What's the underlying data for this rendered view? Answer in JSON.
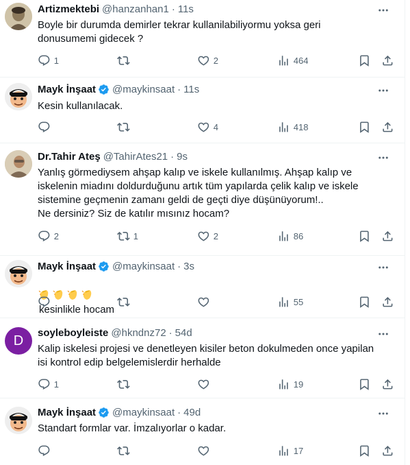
{
  "tweets": [
    {
      "name": "Artizmektebi",
      "handle": "@hanzanhan1",
      "time": "11s",
      "text": "Boyle bir durumda demirler tekrar kullanilabiliyormu yoksa geri\ndonusumemi gidecek ?",
      "replies": "1",
      "retweets": "",
      "likes": "2",
      "views": "464",
      "avatar_icon": "avatar-photo",
      "verified": false
    },
    {
      "name": "Mayk İnşaat",
      "handle": "@maykinsaat",
      "time": "11s",
      "text": "Kesin kullanılacak.",
      "replies": "",
      "retweets": "",
      "likes": "4",
      "views": "418",
      "avatar_icon": "avatar-cartoon",
      "verified": true
    },
    {
      "name": "Dr.Tahir Ateş",
      "handle": "@TahirAtes21",
      "time": "9s",
      "text": "Yanlış görmediysem ahşap kalıp ve iskele kullanılmış. Ahşap kalıp ve\niskelenin miadını doldurduğunu artık tüm yapılarda çelik kalıp ve iskele\nsistemine geçmenin zamanı geldi de geçti diye düşünüyorum!..\nNe dersiniz? Siz de katılır mısınız hocam?",
      "replies": "2",
      "retweets": "1",
      "likes": "2",
      "views": "86",
      "avatar_icon": "avatar-photo",
      "verified": false
    },
    {
      "name": "Mayk İnşaat",
      "handle": "@maykinsaat",
      "time": "3s",
      "text": "kesinlikle hocam",
      "emojis": [
        "clapping-hands-emoji",
        "clapping-hands-emoji",
        "clapping-hands-emoji",
        "clapping-hands-emoji"
      ],
      "replies": "",
      "retweets": "",
      "likes": "",
      "views": "55",
      "avatar_icon": "avatar-cartoon",
      "verified": true
    },
    {
      "name": "soyleboyleiste",
      "handle": "@hkndnz72",
      "time": "54d",
      "text": "Kalip iskelesi projesi ve denetleyen kisiler beton dokulmeden once yapilan\nisi kontrol edip belgelemislerdir herhalde",
      "replies": "1",
      "retweets": "",
      "likes": "",
      "views": "19",
      "avatar_letter": "D",
      "avatar_color": "#7b1fa2",
      "verified": false
    },
    {
      "name": "Mayk İnşaat",
      "handle": "@maykinsaat",
      "time": "49d",
      "text": "Standart formlar var. İmzalıyorlar o kadar.",
      "replies": "",
      "retweets": "",
      "likes": "",
      "views": "17",
      "avatar_icon": "avatar-cartoon",
      "verified": true
    }
  ],
  "colors": {
    "text": "#0f1419",
    "muted": "#536471",
    "verified": "#1d9bf0",
    "border": "#eff3f4"
  }
}
